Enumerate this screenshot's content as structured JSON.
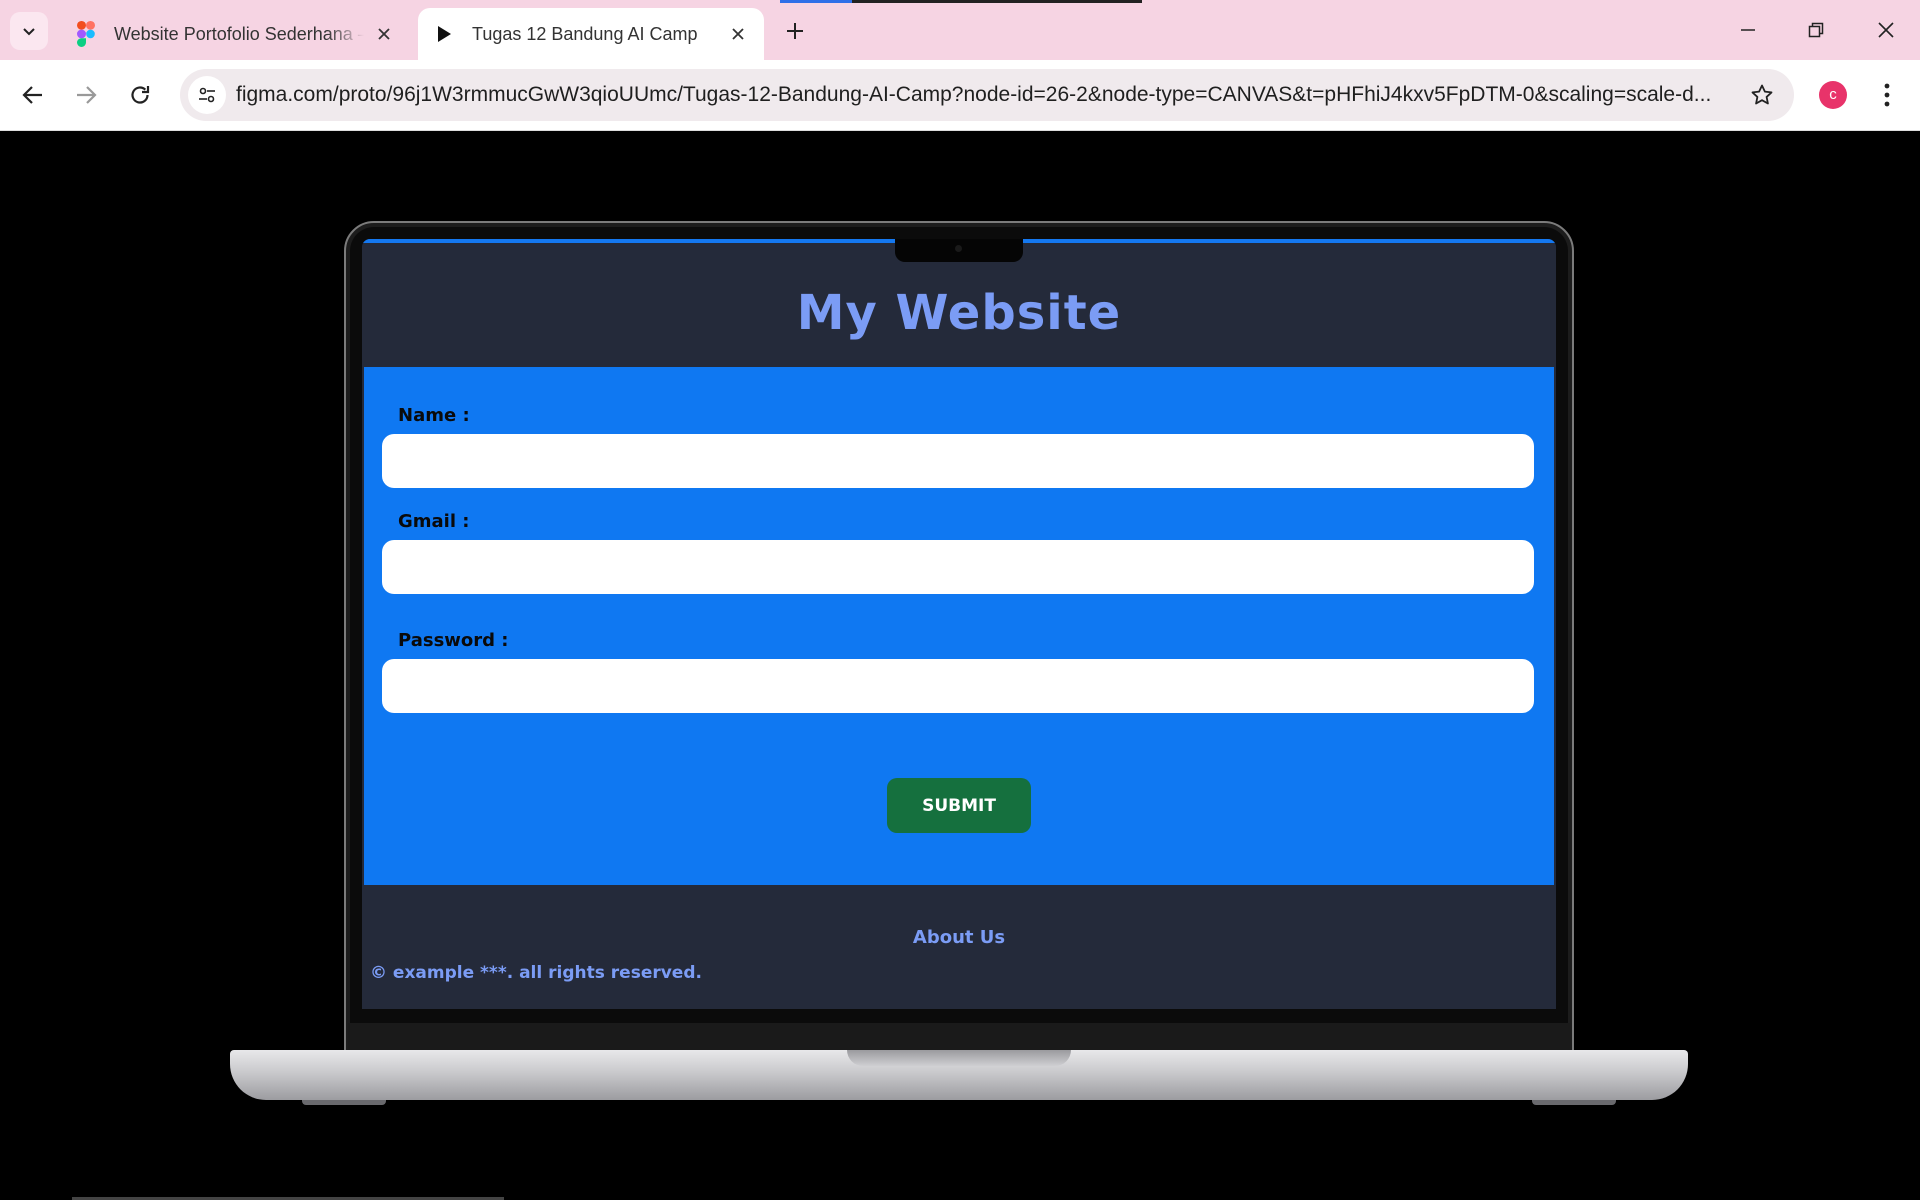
{
  "browser": {
    "tabs": [
      {
        "title": "Website Portofolio Sederhana –",
        "favicon": "figma-icon",
        "active": false
      },
      {
        "title": "Tugas 12 Bandung AI Camp",
        "favicon": "play-icon",
        "active": true
      }
    ],
    "url": "figma.com/proto/96j1W3rmmucGwW3qioUUmc/Tugas-12-Bandung-AI-Camp?node-id=26-2&node-type=CANVAS&t=pHFhiJ4kxv5FpDTM-0&scaling=scale-d...",
    "profile_initial": "c",
    "colors": {
      "tabstrip": "#f6d4e3",
      "profile": "#e8336a"
    }
  },
  "site": {
    "title": "My Website",
    "form": {
      "name_label": "Name :",
      "gmail_label": "Gmail :",
      "password_label": "Password :",
      "name_value": "",
      "gmail_value": "",
      "password_value": "",
      "submit_label": "SUBMIT"
    },
    "footer": {
      "about_link": "About Us",
      "copyright": "© example ***. all rights reserved."
    },
    "colors": {
      "header_bg": "#242a3a",
      "form_bg": "#0f78f2",
      "title": "#7b9cf5",
      "submit_bg": "#15703e"
    }
  }
}
